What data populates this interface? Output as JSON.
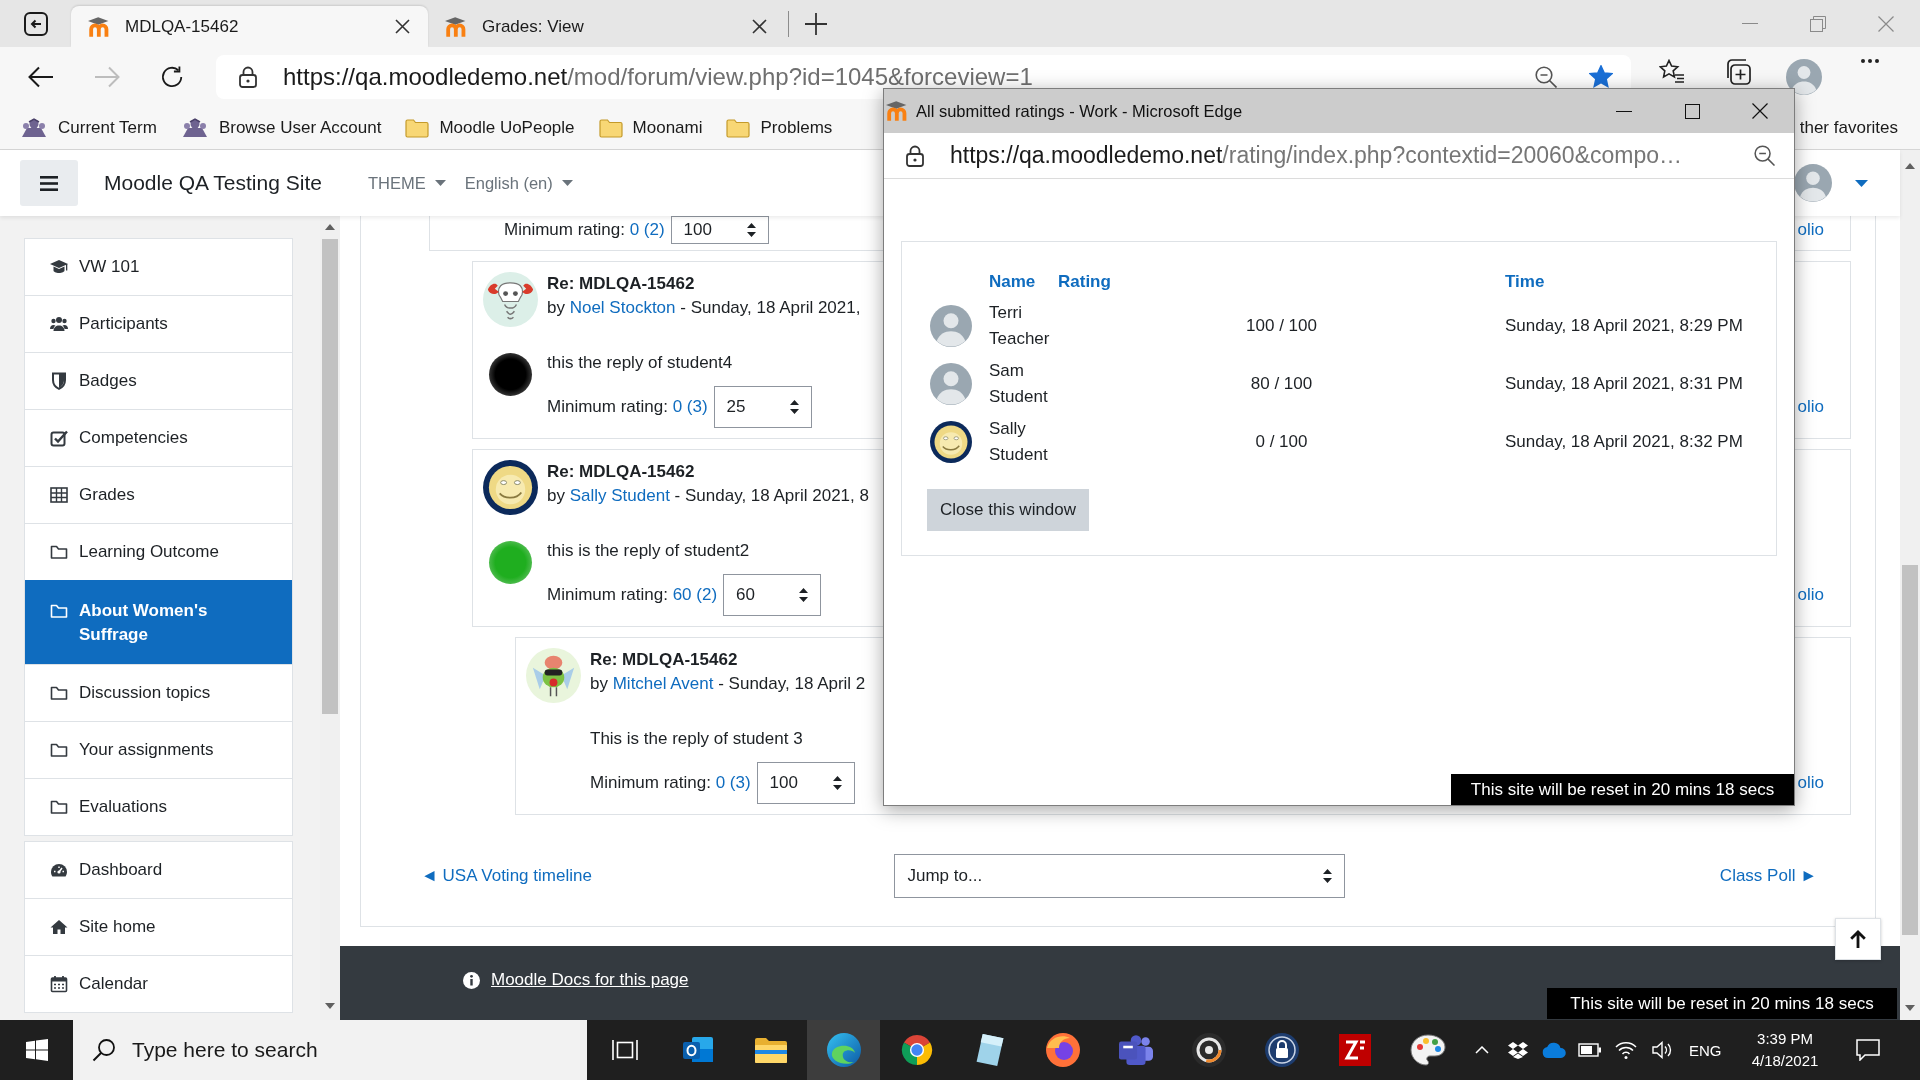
{
  "browser": {
    "tabs": [
      {
        "title": "MDLQA-15462",
        "selected": true
      },
      {
        "title": "Grades: View",
        "selected": false
      }
    ],
    "nav_buttons": [
      {
        "kind": "back",
        "disabled": false
      },
      {
        "kind": "forward",
        "disabled": true
      },
      {
        "kind": "refresh",
        "disabled": false
      }
    ],
    "address": {
      "host": "https://qa.moodledemo.net",
      "path": "/mod/forum/view.php?id=1045&forceview=1",
      "favorite": true
    },
    "bookmarks": [
      {
        "kind": "site",
        "label": "Current Term"
      },
      {
        "kind": "site",
        "label": "Browse User Account"
      },
      {
        "kind": "folder",
        "label": "Moodle UoPeople"
      },
      {
        "kind": "folder",
        "label": "Moonami"
      },
      {
        "kind": "folder",
        "label": "Problems"
      },
      {
        "kind": "more",
        "label": "ther favorites"
      }
    ]
  },
  "moodle": {
    "site_name": "Moodle QA Testing Site",
    "menus": [
      "THEME",
      "English (en)"
    ],
    "drawer": {
      "groups": [
        {
          "items": [
            {
              "kind": "course",
              "label": "VW 101",
              "selected": false
            },
            {
              "kind": "participants",
              "label": "Participants",
              "selected": false
            },
            {
              "kind": "badges",
              "label": "Badges",
              "selected": false
            },
            {
              "kind": "competencies",
              "label": "Competencies",
              "selected": false
            },
            {
              "kind": "grades",
              "label": "Grades",
              "selected": false
            },
            {
              "kind": "section",
              "label": "Learning Outcome",
              "selected": false
            },
            {
              "kind": "section",
              "label": "About Women's Suffrage",
              "selected": true
            },
            {
              "kind": "section",
              "label": "Discussion topics",
              "selected": false
            },
            {
              "kind": "section",
              "label": "Your assignments",
              "selected": false
            },
            {
              "kind": "section",
              "label": "Evaluations",
              "selected": false
            }
          ]
        },
        {
          "items": [
            {
              "kind": "dashboard",
              "label": "Dashboard",
              "selected": false
            },
            {
              "kind": "home",
              "label": "Site home",
              "selected": false
            },
            {
              "kind": "calendar",
              "label": "Calendar",
              "selected": false
            }
          ]
        }
      ]
    },
    "posts": [
      {
        "kind": "partial",
        "rating": {
          "label": "Minimum rating:",
          "count": "0 (2)",
          "value": "100"
        },
        "link": "olio",
        "children": [
          {
            "kind": "full",
            "avatar": {
              "kind": "cartoon"
            },
            "title": "Re: MDLQA-15462",
            "byline": {
              "prefix": "by",
              "author": "Noel Stockton",
              "suffix": "- Sunday, 18 April 2021,"
            },
            "image": {
              "color": "#000000"
            },
            "message": "this the reply of student4",
            "rating": {
              "label": "Minimum rating:",
              "count": "0 (3)",
              "value": "25"
            },
            "link": "olio"
          },
          {
            "kind": "full",
            "avatar": {
              "kind": "smiley"
            },
            "title": "Re: MDLQA-15462",
            "byline": {
              "prefix": "by",
              "author": "Sally Student",
              "suffix": "- Sunday, 18 April 2021, 8"
            },
            "image": {
              "color": "#1fae1f"
            },
            "message": "this is the reply of student2",
            "rating": {
              "label": "Minimum rating:",
              "count": "60 (2)",
              "value": "60"
            },
            "link": "olio",
            "children": [
              {
                "kind": "full",
                "avatar": {
                  "kind": "creature"
                },
                "title": "Re: MDLQA-15462",
                "byline": {
                  "prefix": "by",
                  "author": "Mitchel Avent",
                  "suffix": "- Sunday, 18 April 2"
                },
                "message": "This is the reply of student 3",
                "rating": {
                  "label": "Minimum rating:",
                  "count": "0 (3)",
                  "value": "100"
                },
                "link": "olio"
              }
            ]
          }
        ]
      }
    ],
    "prev_link": "◄ USA Voting timeline",
    "jump": "Jump to...",
    "next_link": "Class Poll ►",
    "docs_link": "Moodle Docs for this page",
    "reset_notice": "This site will be reset in 20 mins 18 secs"
  },
  "popup": {
    "title": "All submitted ratings - Work - Microsoft Edge",
    "url_host": "https://qa.moodledemo.net",
    "url_path": "/rating/index.php?contextid=20060&compo…",
    "columns": [
      "Name",
      "Rating",
      "Time"
    ],
    "rows": [
      {
        "avatar": {
          "kind": "photo"
        },
        "name": "Terri Teacher",
        "rating": "100 / 100",
        "time": "Sunday, 18 April 2021, 8:29 PM"
      },
      {
        "avatar": {
          "kind": "photo"
        },
        "name": "Sam Student",
        "rating": "80 / 100",
        "time": "Sunday, 18 April 2021, 8:31 PM"
      },
      {
        "avatar": {
          "kind": "smiley"
        },
        "name": "Sally Student",
        "rating": "0 / 100",
        "time": "Sunday, 18 April 2021, 8:32 PM"
      }
    ],
    "button": "Close this window",
    "reset_notice": "This site will be reset in 20 mins 18 secs"
  },
  "taskbar": {
    "search": {
      "placeholder": "Type here to search"
    },
    "apps": [
      {
        "kind": "taskview",
        "selected": false
      },
      {
        "kind": "mail",
        "selected": false
      },
      {
        "kind": "files",
        "selected": false
      },
      {
        "kind": "swirl",
        "selected": true
      },
      {
        "kind": "ring",
        "selected": false
      },
      {
        "kind": "pane",
        "selected": false
      },
      {
        "kind": "flame",
        "selected": false
      },
      {
        "kind": "people",
        "selected": false
      },
      {
        "kind": "disc",
        "selected": false
      },
      {
        "kind": "padlock",
        "selected": false
      },
      {
        "kind": "zigzag",
        "selected": false
      },
      {
        "kind": "palette",
        "selected": false
      }
    ],
    "tray": {
      "language": "ENG",
      "time": "3:39 PM",
      "date": "4/18/2021"
    }
  }
}
